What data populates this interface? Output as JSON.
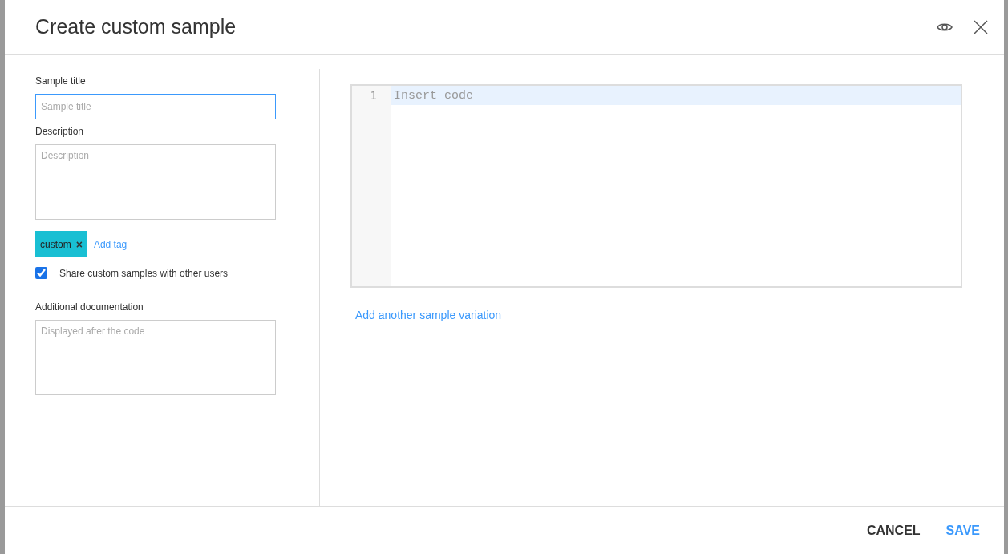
{
  "dialog": {
    "title": "Create custom sample"
  },
  "form": {
    "sample_title": {
      "label": "Sample title",
      "placeholder": "Sample title",
      "focused": true
    },
    "description": {
      "label": "Description",
      "placeholder": "Description"
    },
    "tags": [
      {
        "label": "custom",
        "remove": "×"
      }
    ],
    "add_tag": "Add tag",
    "share": {
      "label": "Share custom samples with other users",
      "checked": true
    },
    "additional_documentation": {
      "label": "Additional documentation",
      "placeholder": "Displayed after the code"
    }
  },
  "editor": {
    "lines": [
      {
        "number": "1",
        "placeholder": "Insert code",
        "active": true
      }
    ]
  },
  "add_variation": "Add another sample variation",
  "buttons": [
    {
      "label": "CANCEL",
      "kind": "secondary"
    },
    {
      "label": "SAVE",
      "kind": "primary"
    }
  ]
}
